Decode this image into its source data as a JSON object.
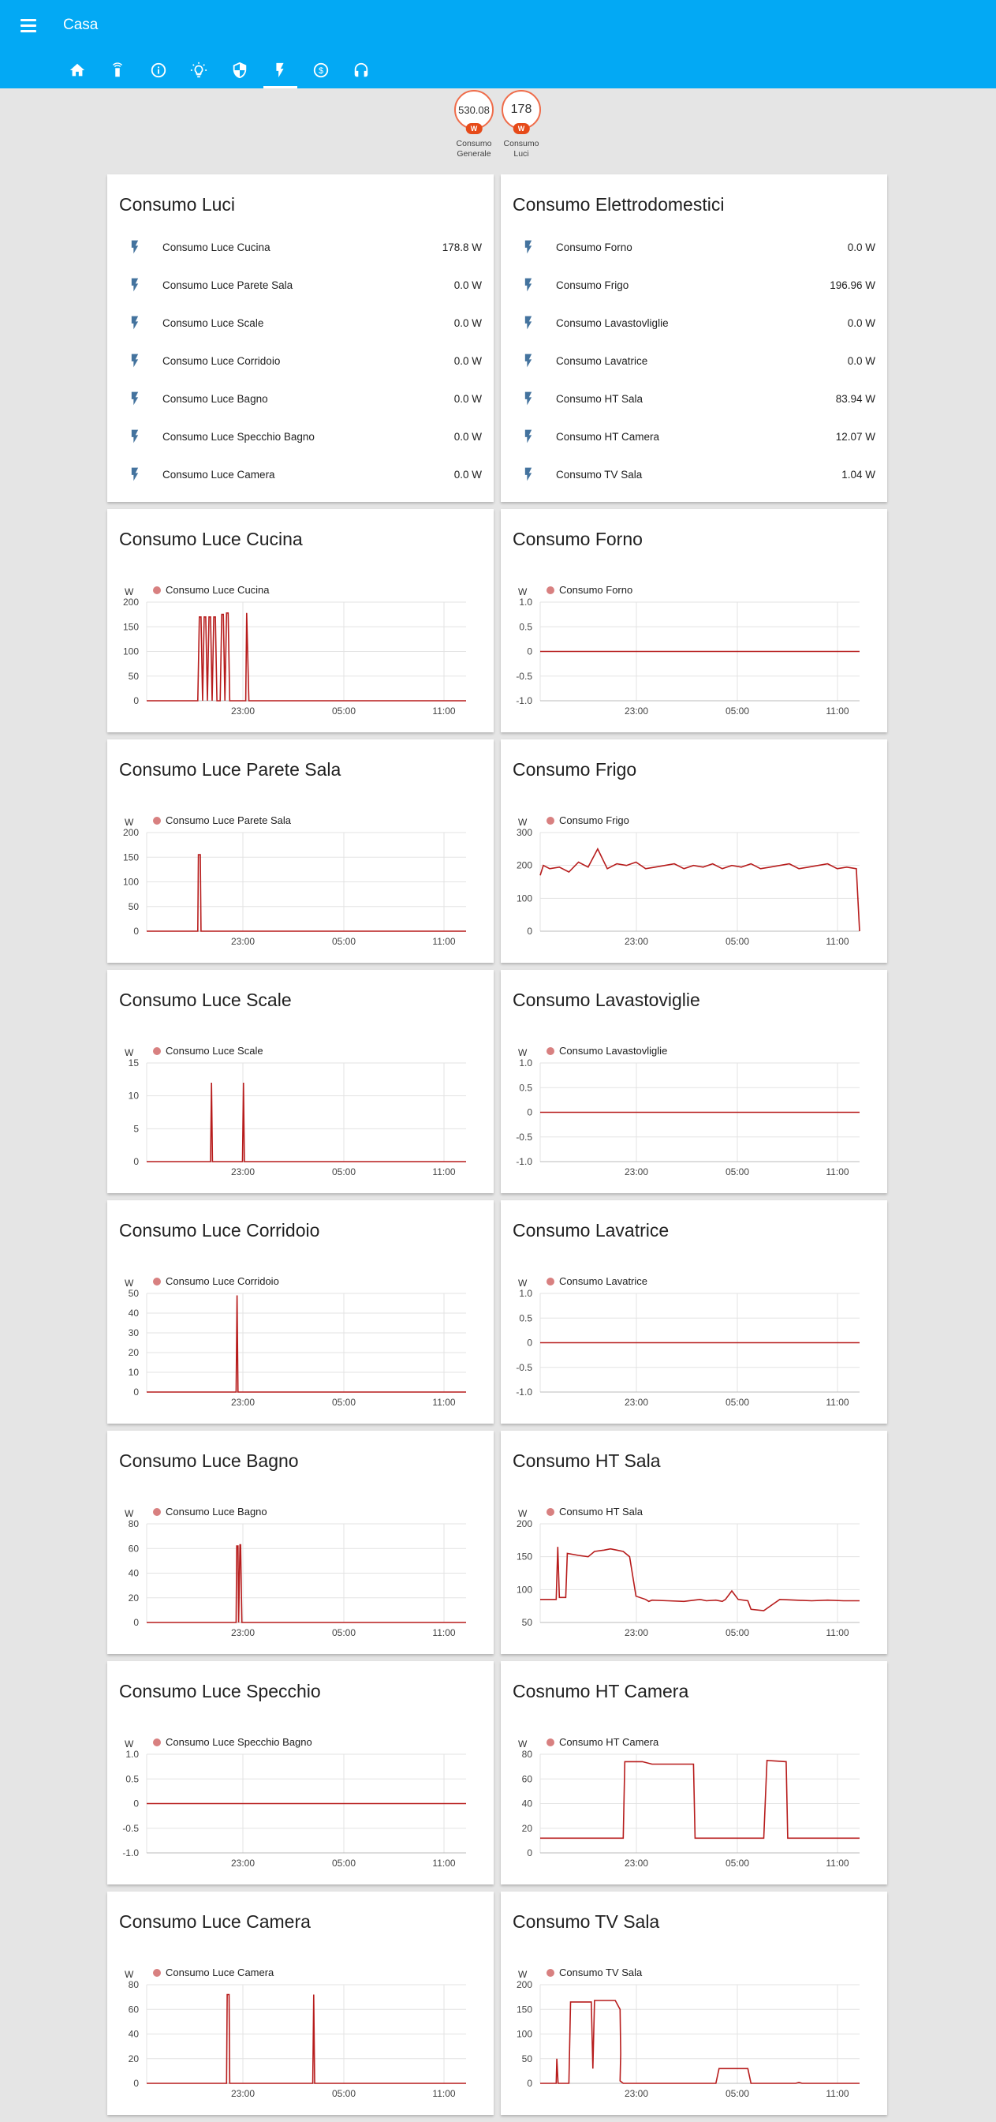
{
  "header": {
    "title": "Casa",
    "menu_icon": "menu-icon"
  },
  "tabs": [
    {
      "icon": "home-icon",
      "active": false
    },
    {
      "icon": "remote-icon",
      "active": false
    },
    {
      "icon": "info-icon",
      "active": false
    },
    {
      "icon": "lightbulb-icon",
      "active": false
    },
    {
      "icon": "shield-icon",
      "active": false
    },
    {
      "icon": "flash-icon",
      "active": true
    },
    {
      "icon": "currency-icon",
      "active": false
    },
    {
      "icon": "headphones-icon",
      "active": false
    }
  ],
  "badges": [
    {
      "value": "530.08",
      "unit": "W",
      "label_l1": "Consumo",
      "label_l2": "Generale"
    },
    {
      "value": "178",
      "unit": "W",
      "label_l1": "Consumo",
      "label_l2": "Luci"
    }
  ],
  "entity_cards": [
    {
      "title": "Consumo Luci",
      "rows": [
        {
          "name": "Consumo Luce Cucina",
          "value": "178.8 W"
        },
        {
          "name": "Consumo Luce Parete Sala",
          "value": "0.0 W"
        },
        {
          "name": "Consumo Luce Scale",
          "value": "0.0 W"
        },
        {
          "name": "Consumo Luce Corridoio",
          "value": "0.0 W"
        },
        {
          "name": "Consumo Luce Bagno",
          "value": "0.0 W"
        },
        {
          "name": "Consumo Luce Specchio Bagno",
          "value": "0.0 W"
        },
        {
          "name": "Consumo Luce Camera",
          "value": "0.0 W"
        }
      ]
    },
    {
      "title": "Consumo Elettrodomestici",
      "rows": [
        {
          "name": "Consumo Forno",
          "value": "0.0 W"
        },
        {
          "name": "Consumo Frigo",
          "value": "196.96 W"
        },
        {
          "name": "Consumo Lavastovliglie",
          "value": "0.0 W"
        },
        {
          "name": "Consumo Lavatrice",
          "value": "0.0 W"
        },
        {
          "name": "Consumo HT Sala",
          "value": "83.94 W"
        },
        {
          "name": "Consumo HT Camera",
          "value": "12.07 W"
        },
        {
          "name": "Consumo TV Sala",
          "value": "1.04 W"
        }
      ]
    }
  ],
  "colors": {
    "header": "#03a9f4",
    "line": "#b71c1c",
    "legend_dot": "#d88080",
    "icon": "#44739e",
    "badge_border": "#ef6c4a"
  },
  "x_tick_labels": [
    "23:00",
    "05:00",
    "11:00"
  ],
  "chart_data": [
    {
      "type": "line",
      "title": "Consumo Luce Cucina",
      "unit": "W",
      "series": [
        {
          "name": "Consumo Luce Cucina",
          "x": [
            0,
            0.16,
            0.165,
            0.17,
            0.175,
            0.18,
            0.185,
            0.19,
            0.195,
            0.2,
            0.205,
            0.21,
            0.215,
            0.22,
            0.225,
            0.23,
            0.235,
            0.24,
            0.245,
            0.25,
            0.255,
            0.26,
            0.265,
            0.27,
            0.275,
            0.28,
            0.285,
            0.29,
            0.31,
            0.313,
            0.32,
            1
          ],
          "y": [
            0,
            0,
            170,
            170,
            0,
            170,
            170,
            0,
            170,
            170,
            0,
            170,
            170,
            0,
            0,
            0,
            175,
            175,
            0,
            178,
            178,
            0,
            0,
            0,
            0,
            0,
            0,
            0,
            0,
            178,
            0,
            0
          ]
        }
      ],
      "y_ticks": [
        0,
        50,
        100,
        150,
        200
      ],
      "ylim": [
        0,
        200
      ]
    },
    {
      "type": "line",
      "title": "Consumo Forno",
      "unit": "W",
      "series": [
        {
          "name": "Consumo Forno",
          "x": [
            0,
            1
          ],
          "y": [
            0,
            0
          ]
        }
      ],
      "y_ticks": [
        -1.0,
        -0.5,
        0,
        0.5,
        1.0
      ],
      "ylim": [
        -1,
        1
      ]
    },
    {
      "type": "line",
      "title": "Consumo Luce Parete Sala",
      "unit": "W",
      "series": [
        {
          "name": "Consumo Luce Parete Sala",
          "x": [
            0,
            0.16,
            0.162,
            0.168,
            0.17,
            1
          ],
          "y": [
            0,
            0,
            155,
            155,
            0,
            0
          ]
        }
      ],
      "y_ticks": [
        0,
        50,
        100,
        150,
        200
      ],
      "ylim": [
        0,
        200
      ]
    },
    {
      "type": "line",
      "title": "Consumo Frigo",
      "unit": "W",
      "series": [
        {
          "name": "Consumo Frigo",
          "x": [
            0,
            0.01,
            0.03,
            0.06,
            0.09,
            0.12,
            0.15,
            0.18,
            0.21,
            0.24,
            0.27,
            0.3,
            0.33,
            0.36,
            0.39,
            0.42,
            0.45,
            0.48,
            0.51,
            0.54,
            0.57,
            0.6,
            0.63,
            0.66,
            0.69,
            0.72,
            0.75,
            0.78,
            0.81,
            0.84,
            0.87,
            0.9,
            0.93,
            0.96,
            0.99,
            1
          ],
          "y": [
            170,
            200,
            190,
            195,
            180,
            210,
            195,
            250,
            190,
            205,
            200,
            210,
            190,
            195,
            200,
            205,
            190,
            200,
            195,
            205,
            190,
            200,
            195,
            205,
            190,
            195,
            200,
            205,
            190,
            195,
            200,
            205,
            190,
            195,
            190,
            0
          ]
        }
      ],
      "y_ticks": [
        0,
        100,
        200,
        300
      ],
      "ylim": [
        0,
        300
      ]
    },
    {
      "type": "line",
      "title": "Consumo Luce Scale",
      "unit": "W",
      "series": [
        {
          "name": "Consumo Luce Scale",
          "x": [
            0,
            0.2,
            0.203,
            0.206,
            0.3,
            0.303,
            0.306,
            1
          ],
          "y": [
            0,
            0,
            12,
            0,
            0,
            12,
            0,
            0
          ]
        }
      ],
      "y_ticks": [
        0,
        5,
        10,
        15
      ],
      "ylim": [
        0,
        15
      ]
    },
    {
      "type": "line",
      "title": "Consumo Lavastoviglie",
      "unit": "W",
      "series": [
        {
          "name": "Consumo Lavastovliglie",
          "x": [
            0,
            1
          ],
          "y": [
            0,
            0
          ]
        }
      ],
      "y_ticks": [
        -1.0,
        -0.5,
        0,
        0.5,
        1.0
      ],
      "ylim": [
        -1,
        1
      ]
    },
    {
      "type": "line",
      "title": "Consumo Luce Corridoio",
      "unit": "W",
      "series": [
        {
          "name": "Consumo Luce Corridoio",
          "x": [
            0,
            0.28,
            0.283,
            0.286,
            1
          ],
          "y": [
            0,
            0,
            49,
            0,
            0
          ]
        }
      ],
      "y_ticks": [
        0,
        10,
        20,
        30,
        40,
        50
      ],
      "ylim": [
        0,
        50
      ]
    },
    {
      "type": "line",
      "title": "Consumo Lavatrice",
      "unit": "W",
      "series": [
        {
          "name": "Consumo Lavatrice",
          "x": [
            0,
            1
          ],
          "y": [
            0,
            0
          ]
        }
      ],
      "y_ticks": [
        -1.0,
        -0.5,
        0,
        0.5,
        1.0
      ],
      "ylim": [
        -1,
        1
      ]
    },
    {
      "type": "line",
      "title": "Consumo Luce Bagno",
      "unit": "W",
      "series": [
        {
          "name": "Consumo Luce Bagno",
          "x": [
            0,
            0.28,
            0.282,
            0.286,
            0.288,
            0.292,
            0.294,
            0.298,
            0.3,
            1
          ],
          "y": [
            0,
            0,
            62,
            62,
            0,
            63,
            63,
            0,
            0,
            0
          ]
        }
      ],
      "y_ticks": [
        0,
        20,
        40,
        60,
        80
      ],
      "ylim": [
        0,
        80
      ]
    },
    {
      "type": "line",
      "title": "Consumo HT Sala",
      "unit": "W",
      "series": [
        {
          "name": "Consumo HT Sala",
          "x": [
            0,
            0.05,
            0.055,
            0.06,
            0.08,
            0.085,
            0.12,
            0.15,
            0.17,
            0.2,
            0.22,
            0.24,
            0.26,
            0.28,
            0.3,
            0.33,
            0.34,
            0.35,
            0.4,
            0.45,
            0.5,
            0.52,
            0.55,
            0.57,
            0.58,
            0.6,
            0.62,
            0.65,
            0.66,
            0.7,
            0.75,
            0.8,
            0.85,
            0.9,
            0.95,
            1
          ],
          "y": [
            85,
            85,
            165,
            88,
            88,
            155,
            152,
            150,
            158,
            160,
            162,
            160,
            158,
            150,
            90,
            85,
            82,
            84,
            83,
            82,
            85,
            83,
            84,
            82,
            85,
            98,
            85,
            83,
            70,
            68,
            85,
            84,
            83,
            84,
            83,
            83
          ]
        }
      ],
      "y_ticks": [
        50,
        100,
        150,
        200
      ],
      "ylim": [
        50,
        200
      ]
    },
    {
      "type": "line",
      "title": "Consumo Luce Specchio",
      "unit": "W",
      "series": [
        {
          "name": "Consumo Luce Specchio Bagno",
          "x": [
            0,
            1
          ],
          "y": [
            0,
            0
          ]
        }
      ],
      "y_ticks": [
        -1.0,
        -0.5,
        0,
        0.5,
        1.0
      ],
      "ylim": [
        -1,
        1
      ]
    },
    {
      "type": "line",
      "title": "Cosnumo HT Camera",
      "unit": "W",
      "series": [
        {
          "name": "Consumo HT Camera",
          "x": [
            0,
            0.26,
            0.265,
            0.32,
            0.35,
            0.48,
            0.485,
            0.7,
            0.71,
            0.77,
            0.775,
            1
          ],
          "y": [
            12,
            12,
            74,
            74,
            72,
            72,
            12,
            12,
            75,
            74,
            12,
            12
          ]
        }
      ],
      "y_ticks": [
        0,
        20,
        40,
        60,
        80
      ],
      "ylim": [
        0,
        80
      ]
    },
    {
      "type": "line",
      "title": "Consumo Luce Camera",
      "unit": "W",
      "series": [
        {
          "name": "Consumo Luce Camera",
          "x": [
            0,
            0.25,
            0.252,
            0.258,
            0.26,
            0.52,
            0.523,
            0.526,
            1
          ],
          "y": [
            0,
            0,
            72,
            72,
            0,
            0,
            72,
            0,
            0
          ]
        }
      ],
      "y_ticks": [
        0,
        20,
        40,
        60,
        80
      ],
      "ylim": [
        0,
        80
      ]
    },
    {
      "type": "line",
      "title": "Consumo TV Sala",
      "unit": "W",
      "series": [
        {
          "name": "Consumo TV Sala",
          "x": [
            0,
            0.05,
            0.052,
            0.056,
            0.06,
            0.09,
            0.095,
            0.16,
            0.165,
            0.17,
            0.23,
            0.235,
            0.25,
            0.252,
            0.25,
            0.26,
            0.55,
            0.56,
            0.65,
            0.66,
            0.8,
            0.81,
            0.82,
            1
          ],
          "y": [
            0,
            0,
            50,
            0,
            0,
            0,
            165,
            165,
            30,
            168,
            168,
            168,
            150,
            60,
            5,
            0,
            0,
            30,
            30,
            0,
            0,
            2,
            0,
            0
          ]
        }
      ],
      "y_ticks": [
        0,
        50,
        100,
        150,
        200
      ],
      "ylim": [
        0,
        200
      ]
    }
  ]
}
